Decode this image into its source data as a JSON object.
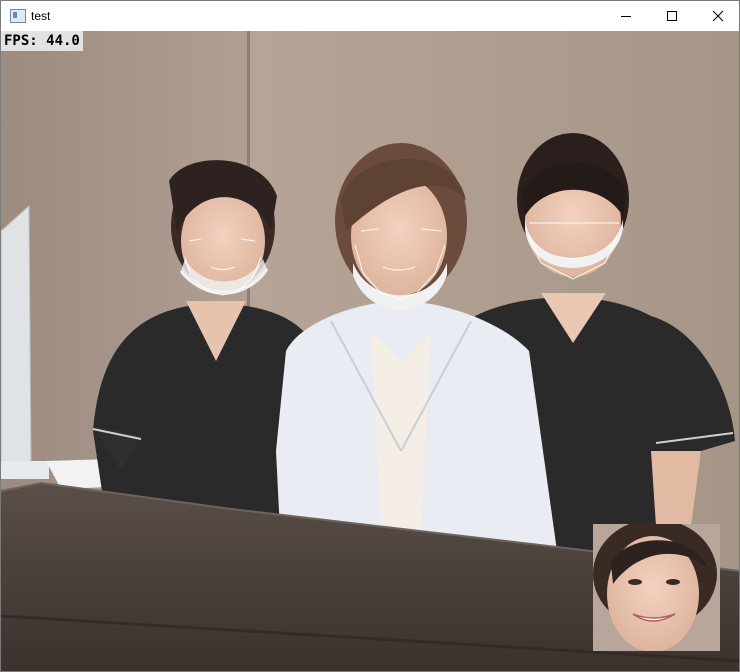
{
  "window": {
    "title": "test",
    "app_icon": "window-app-icon",
    "controls": {
      "minimize": "minimize-icon",
      "maximize": "maximize-icon",
      "close": "close-icon"
    }
  },
  "overlay": {
    "fps_text": "FPS: 44.0"
  },
  "scene": {
    "people_count": 3,
    "faces_with_landmark_overlay": 3,
    "thumbnail": "detected-face-crop"
  },
  "colors": {
    "titlebar": "#ffffff",
    "wall": "#a59385",
    "uniform_dark": "#2b2b2b",
    "coat": "#e9ecf3",
    "counter": "#4a403a",
    "landmark": "#ffffff"
  }
}
